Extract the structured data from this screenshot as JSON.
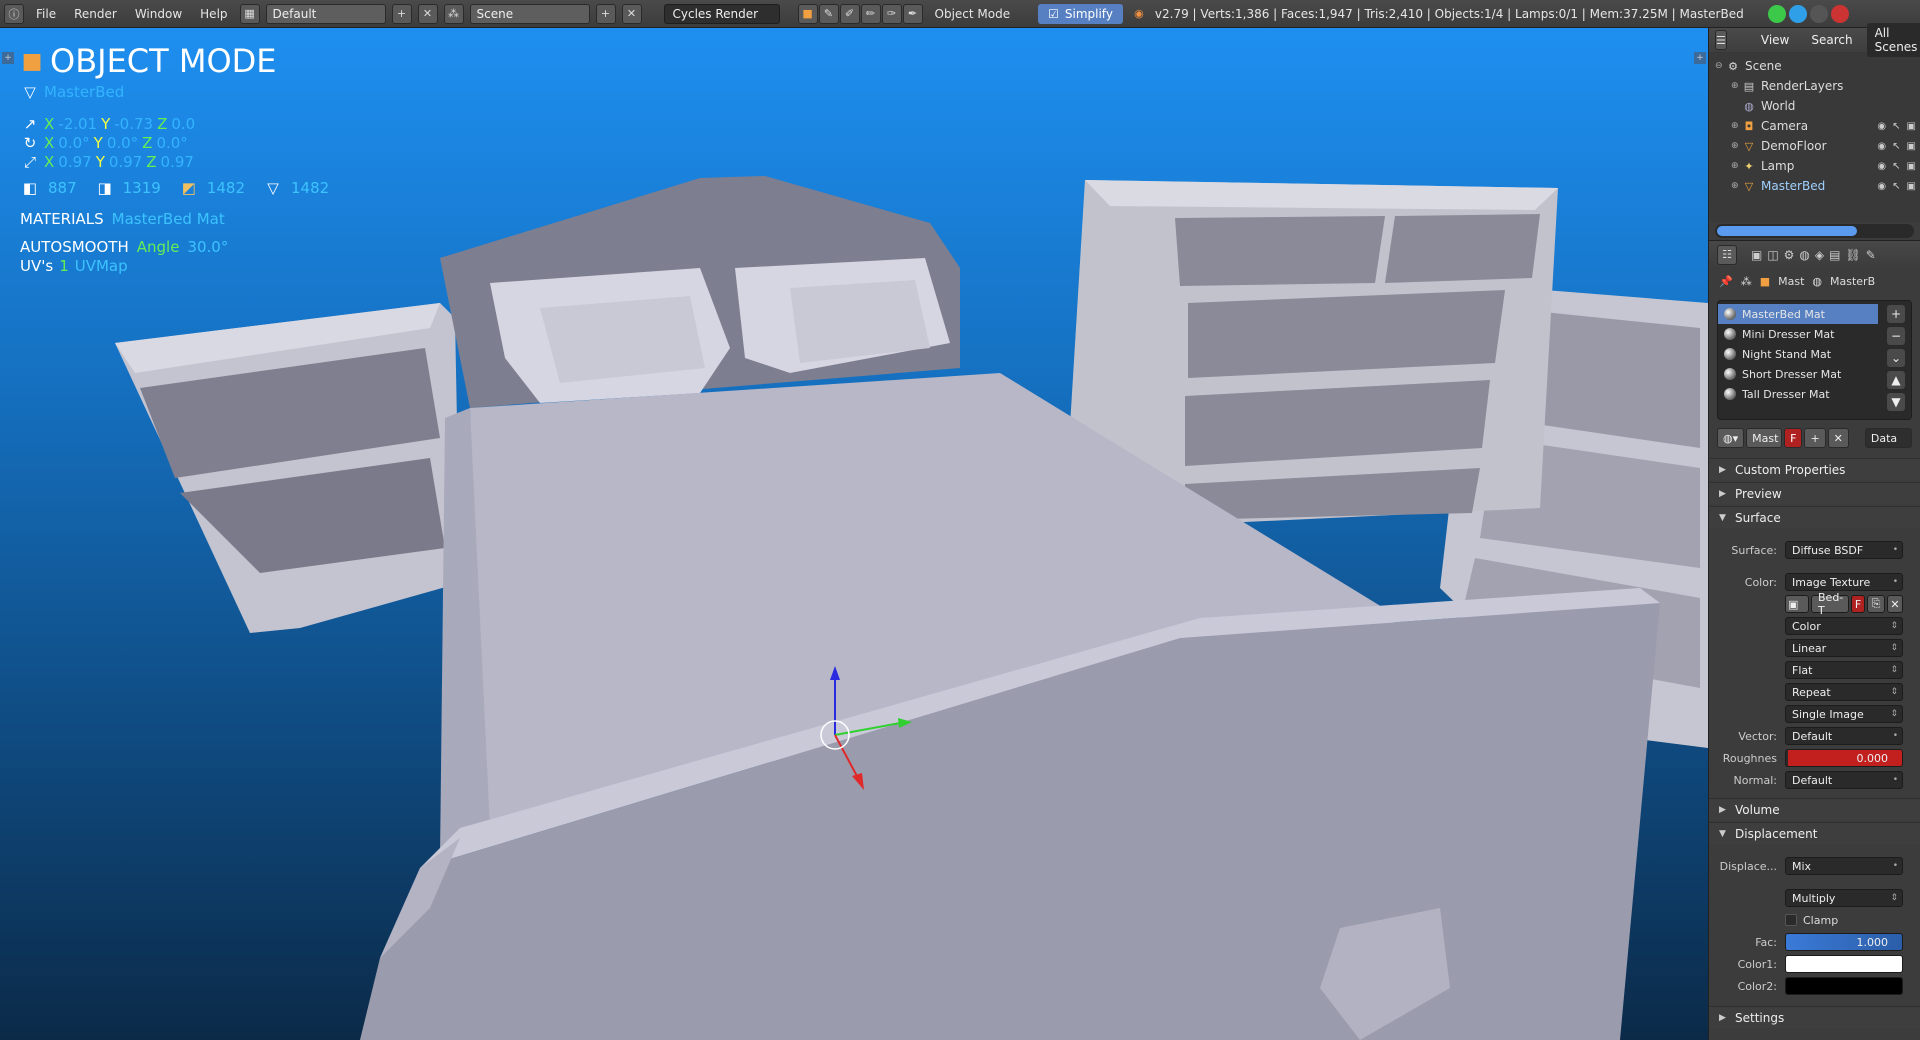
{
  "topbar": {
    "menu": [
      "File",
      "Render",
      "Window",
      "Help"
    ],
    "layout_name": "Default",
    "scene_name": "Scene",
    "render_engine": "Cycles Render",
    "mode_label": "Object Mode",
    "simplify_label": "Simplify",
    "stats": "v2.79 | Verts:1,386 | Faces:1,947 | Tris:2,410 | Objects:1/4 | Lamps:0/1 | Mem:37.25M | MasterBed"
  },
  "hud": {
    "mode_title": "OBJECT MODE",
    "object_name": "MasterBed",
    "location": {
      "x_label": "X",
      "x": "-2.01",
      "y_label": "Y",
      "y": "-0.73",
      "z_label": "Z",
      "z": "0.0"
    },
    "rotation": {
      "x_label": "X",
      "x": "0.0°",
      "y_label": "Y",
      "y": "0.0°",
      "z_label": "Z",
      "z": "0.0°"
    },
    "scale": {
      "x_label": "X",
      "x": "0.97",
      "y_label": "Y",
      "y": "0.97",
      "z_label": "Z",
      "z": "0.97"
    },
    "counts": [
      "887",
      "1319",
      "1482",
      "1482"
    ],
    "materials_label": "MATERIALS",
    "materials_value": "MasterBed Mat",
    "autosmooth_label": "AUTOSMOOTH",
    "angle_label": "Angle",
    "angle_value": "30.0°",
    "uvs_label": "UV's",
    "uvs_count": "1",
    "uvs_name": "UVMap"
  },
  "outliner": {
    "tabs": [
      "View",
      "Search",
      "All Scenes"
    ],
    "items": [
      {
        "name": "Scene",
        "icon": "scene-icon"
      },
      {
        "name": "RenderLayers",
        "icon": "renderlayers-icon"
      },
      {
        "name": "World",
        "icon": "world-icon"
      },
      {
        "name": "Camera",
        "icon": "camera-icon"
      },
      {
        "name": "DemoFloor",
        "icon": "mesh-icon"
      },
      {
        "name": "Lamp",
        "icon": "lamp-icon"
      },
      {
        "name": "MasterBed",
        "icon": "mesh-icon"
      }
    ]
  },
  "properties": {
    "breadcrumb": [
      "Mast",
      "MasterB"
    ],
    "materials": [
      "MasterBed Mat",
      "Mini Dresser Mat",
      "Night Stand Mat",
      "Short Dresser Mat",
      "Tall Dresser Mat"
    ],
    "selected_material": "MasterBed Mat",
    "mat_field": "Mast",
    "mat_users": "F",
    "link_label": "Data",
    "sections": {
      "custom_properties": "Custom Properties",
      "preview": "Preview",
      "surface": "Surface",
      "volume": "Volume",
      "displacement": "Displacement",
      "settings": "Settings"
    },
    "surface": {
      "surface_label": "Surface:",
      "surface_value": "Diffuse BSDF",
      "color_label": "Color:",
      "color_value": "Image Texture",
      "image_name": "Bed-T",
      "image_users": "F",
      "color_space": "Color",
      "interpolation": "Linear",
      "projection": "Flat",
      "extension": "Repeat",
      "source": "Single Image",
      "vector_label": "Vector:",
      "vector_value": "Default",
      "roughness_label": "Roughnes",
      "roughness_value": "0.000",
      "normal_label": "Normal:",
      "normal_value": "Default"
    },
    "displacement": {
      "displace_label": "Displace...",
      "displace_value": "Mix",
      "blend_value": "Multiply",
      "clamp_label": "Clamp",
      "fac_label": "Fac:",
      "fac_value": "1.000",
      "color1_label": "Color1:",
      "color1_hex": "#ffffff",
      "color2_label": "Color2:",
      "color2_hex": "#000000"
    }
  },
  "colors": {
    "viewport_top": "#1e8ff0",
    "viewport_bottom": "#0b2a48",
    "accent": "#5680c2",
    "roughness_bar": "#c21f1f",
    "fac_bar": "#3a7ad8"
  }
}
